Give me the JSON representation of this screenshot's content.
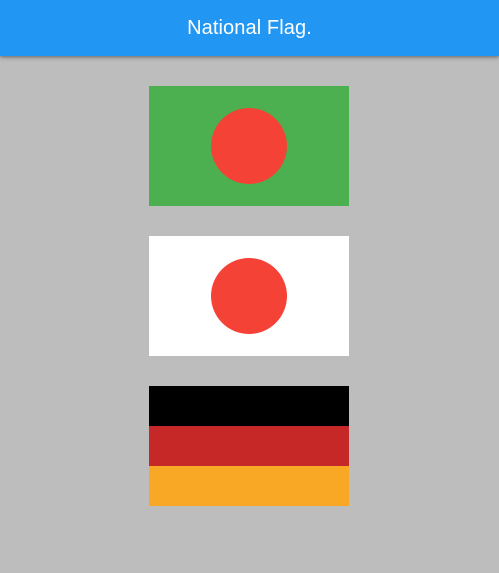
{
  "app_bar": {
    "title": "National Flag.",
    "background_color": "#2196f3",
    "text_color": "#ffffff"
  },
  "page": {
    "background_color": "#bdbdbd"
  },
  "flags": [
    {
      "name": "bangladesh",
      "type": "circle-on-field",
      "field_color": "#4caf50",
      "circle_color": "#f44336"
    },
    {
      "name": "japan",
      "type": "circle-on-field",
      "field_color": "#ffffff",
      "circle_color": "#f44336"
    },
    {
      "name": "germany",
      "type": "horizontal-stripes",
      "stripe_colors": [
        "#000000",
        "#c62828",
        "#f9a825"
      ]
    }
  ]
}
